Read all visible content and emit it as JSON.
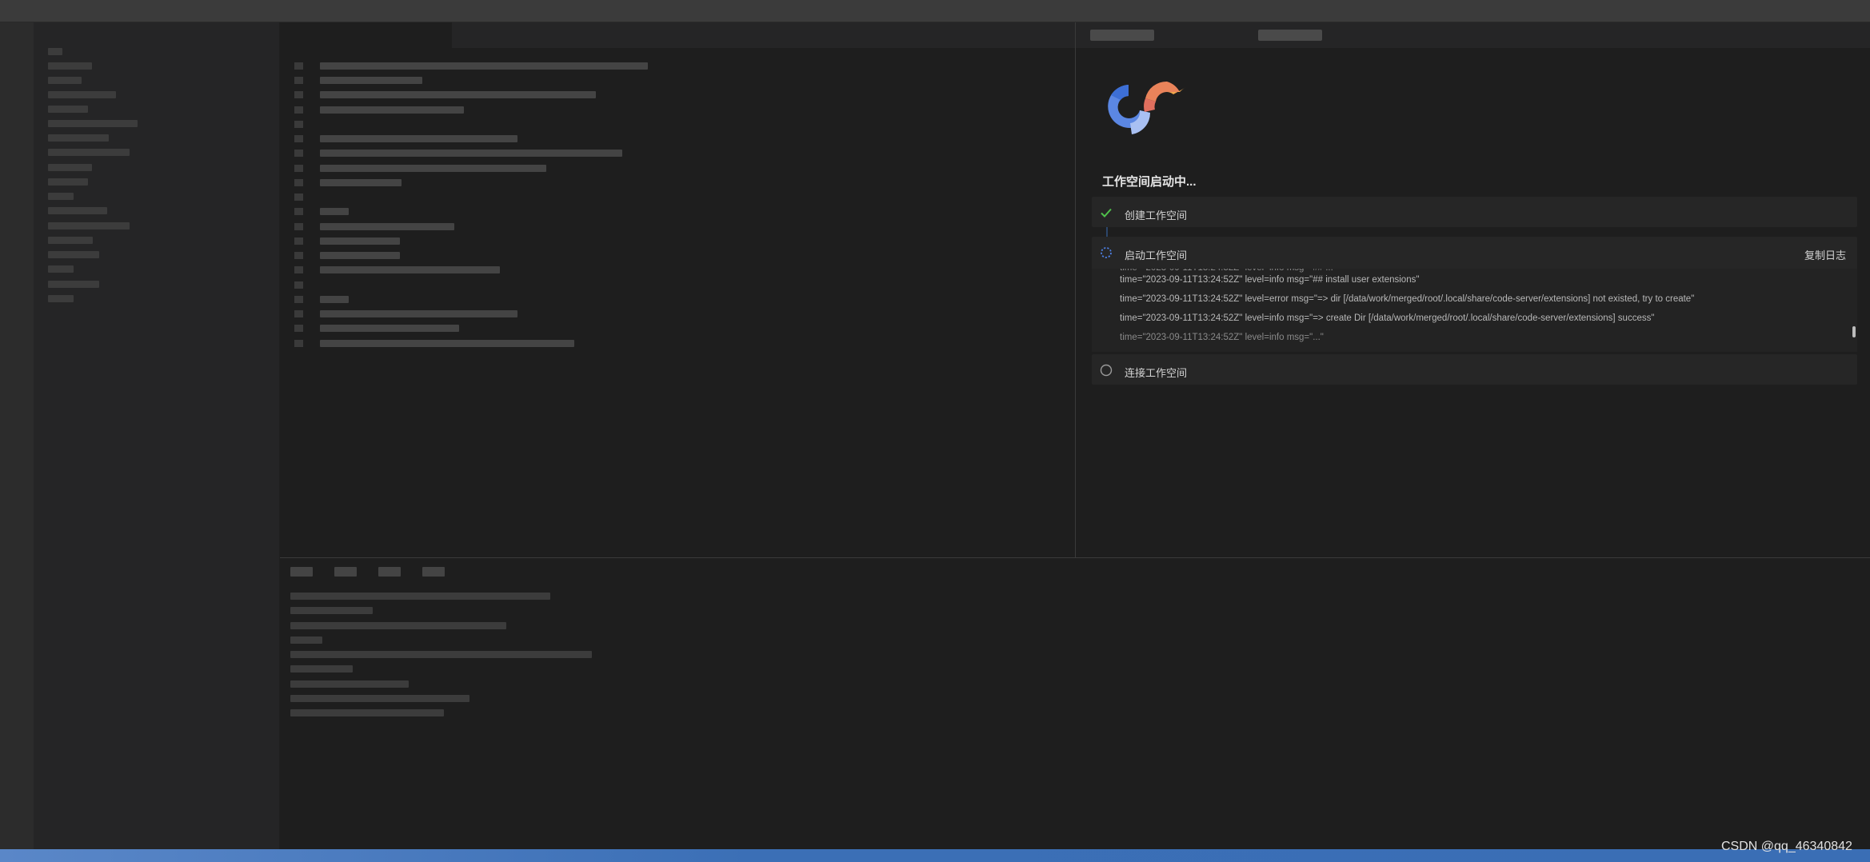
{
  "workspace": {
    "title": "工作空间启动中...",
    "steps": [
      {
        "label": "创建工作空间",
        "status": "done"
      },
      {
        "label": "启动工作空间",
        "status": "loading"
      },
      {
        "label": "连接工作空间",
        "status": "pending"
      }
    ],
    "copy_log_label": "复制日志",
    "log_lines": [
      "time=\"2023-09-11T13:24:52Z\" level=info msg=\"## install user extensions\"",
      "time=\"2023-09-11T13:24:52Z\" level=error msg=\"=> dir [/data/work/merged/root/.local/share/code-server/extensions] not existed, try to create\"",
      "time=\"2023-09-11T13:24:52Z\" level=info msg=\"=> create Dir [/data/work/merged/root/.local/share/code-server/extensions] success\""
    ]
  },
  "colors": {
    "accent_blue": "#3a6eb5",
    "check_green": "#4fc14b",
    "logo_blue": "#5b87e3",
    "logo_orange": "#e9835a"
  },
  "watermark": "CSDN @qq_46340842"
}
